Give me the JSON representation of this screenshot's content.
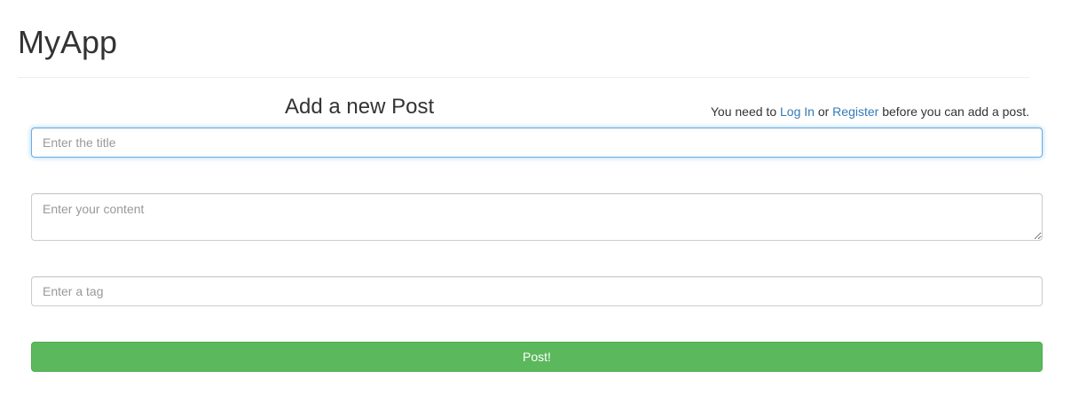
{
  "app": {
    "title": "MyApp"
  },
  "form": {
    "heading": "Add a new Post",
    "title_placeholder": "Enter the title",
    "title_value": "",
    "content_placeholder": "Enter your content",
    "content_value": "",
    "tag_placeholder": "Enter a tag",
    "tag_value": "",
    "submit_label": "Post!"
  },
  "notice": {
    "prefix": "You need to ",
    "login_link": "Log In",
    "middle": " or ",
    "register_link": "Register",
    "suffix": " before you can add a post."
  },
  "colors": {
    "link": "#337ab7",
    "primary_button": "#5cb85c",
    "focus_border": "#66afe9"
  }
}
